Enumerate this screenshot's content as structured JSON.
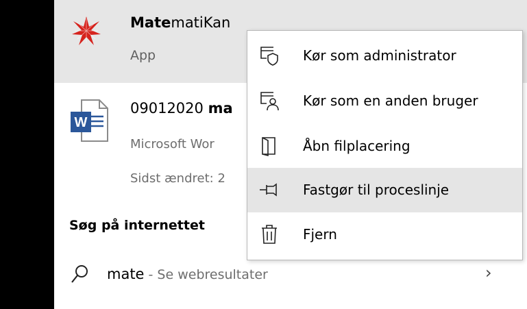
{
  "top_result": {
    "title_bold": "Mate",
    "title_rest": "matiKan",
    "subtitle": "App"
  },
  "document_result": {
    "title_prefix": "09012020 ",
    "title_bold": "ma",
    "type": "Microsoft Wor",
    "modified": "Sidst ændret: 2"
  },
  "web_section": {
    "title": "Søg på internettet",
    "query": "mate",
    "separator": " - ",
    "hint": "Se webresultater"
  },
  "context_menu": {
    "items": [
      {
        "label": "Kør som administrator",
        "icon": "run-as-admin-icon"
      },
      {
        "label": "Kør som en anden bruger",
        "icon": "run-as-other-user-icon"
      },
      {
        "label": "Åbn filplacering",
        "icon": "open-file-location-icon"
      },
      {
        "label": "Fastgør til proceslinje",
        "icon": "pin-icon",
        "hovered": true
      },
      {
        "label": "Fjern",
        "icon": "trash-icon"
      }
    ]
  },
  "colors": {
    "highlight": "#e6e6e6",
    "menu_hover": "#e5e5e5",
    "word_blue": "#2b579a",
    "mathematica_red": "#d6231d"
  }
}
